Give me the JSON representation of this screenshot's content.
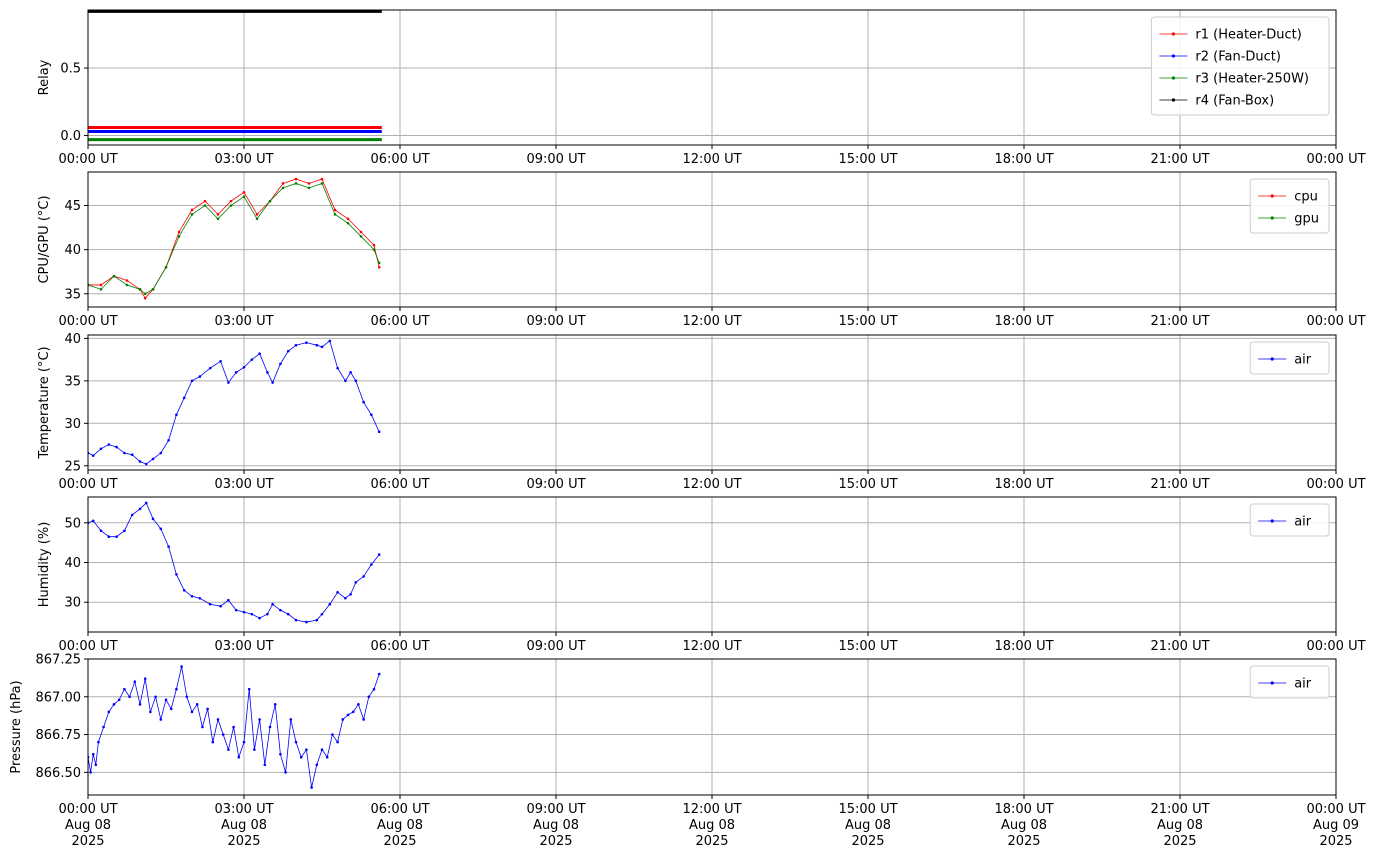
{
  "chart_data": [
    {
      "type": "line",
      "ylabel": "Relay",
      "ylim": [
        -0.07,
        0.93
      ],
      "yticks": [
        {
          "v": 0.0,
          "label": "0.0"
        },
        {
          "v": 0.5,
          "label": "0.5"
        }
      ],
      "x_range": [
        "00:00",
        "24:00"
      ],
      "x_tick_labels": [
        "00:00 UT",
        "03:00 UT",
        "06:00 UT",
        "09:00 UT",
        "12:00 UT",
        "15:00 UT",
        "18:00 UT",
        "21:00 UT",
        "00:00 UT"
      ],
      "grid": true,
      "legend_placement": "top-right",
      "series": [
        {
          "name": "r1 (Heater-Duct)",
          "color": "#ff0000",
          "x": [
            0,
            5.65
          ],
          "y": [
            0.06,
            0.06
          ]
        },
        {
          "name": "r2 (Fan-Duct)",
          "color": "#0000ff",
          "x": [
            0,
            5.65
          ],
          "y": [
            0.03,
            0.03
          ]
        },
        {
          "name": "r3 (Heater-250W)",
          "color": "#008000",
          "x": [
            0,
            5.65
          ],
          "y": [
            -0.03,
            -0.03
          ]
        },
        {
          "name": "r4 (Fan-Box)",
          "color": "#000000",
          "x": [
            0,
            5.65
          ],
          "y": [
            0.92,
            0.92
          ]
        }
      ]
    },
    {
      "type": "line",
      "ylabel": "CPU/GPU (°C)",
      "ylim": [
        33.5,
        48.8
      ],
      "yticks": [
        {
          "v": 35,
          "label": "35"
        },
        {
          "v": 40,
          "label": "40"
        },
        {
          "v": 45,
          "label": "45"
        }
      ],
      "x_range": [
        "00:00",
        "24:00"
      ],
      "x_tick_labels": [
        "00:00 UT",
        "03:00 UT",
        "06:00 UT",
        "09:00 UT",
        "12:00 UT",
        "15:00 UT",
        "18:00 UT",
        "21:00 UT",
        "00:00 UT"
      ],
      "grid": true,
      "legend_placement": "top-right",
      "series": [
        {
          "name": "cpu",
          "color": "#ff0000",
          "x": [
            0,
            0.25,
            0.5,
            0.75,
            1.0,
            1.1,
            1.25,
            1.5,
            1.75,
            2.0,
            2.25,
            2.5,
            2.75,
            3.0,
            3.25,
            3.5,
            3.75,
            4.0,
            4.25,
            4.5,
            4.75,
            5.0,
            5.25,
            5.5,
            5.6
          ],
          "y": [
            36.0,
            36.0,
            37.0,
            36.5,
            35.5,
            34.5,
            35.5,
            38.0,
            42.0,
            44.5,
            45.5,
            44.0,
            45.5,
            46.5,
            44.0,
            45.5,
            47.5,
            48.0,
            47.5,
            48.0,
            44.5,
            43.5,
            42.0,
            40.5,
            38.0
          ]
        },
        {
          "name": "gpu",
          "color": "#008000",
          "x": [
            0,
            0.25,
            0.5,
            0.75,
            1.0,
            1.1,
            1.25,
            1.5,
            1.75,
            2.0,
            2.25,
            2.5,
            2.75,
            3.0,
            3.25,
            3.5,
            3.75,
            4.0,
            4.25,
            4.5,
            4.75,
            5.0,
            5.25,
            5.5,
            5.6
          ],
          "y": [
            36.0,
            35.5,
            37.0,
            36.0,
            35.5,
            35.0,
            35.5,
            38.0,
            41.5,
            44.0,
            45.0,
            43.5,
            45.0,
            46.0,
            43.5,
            45.5,
            47.0,
            47.5,
            47.0,
            47.5,
            44.0,
            43.0,
            41.5,
            40.0,
            38.5
          ]
        }
      ]
    },
    {
      "type": "line",
      "ylabel": "Temperature (°C)",
      "ylim": [
        24.5,
        40.4
      ],
      "yticks": [
        {
          "v": 25,
          "label": "25"
        },
        {
          "v": 30,
          "label": "30"
        },
        {
          "v": 35,
          "label": "35"
        },
        {
          "v": 40,
          "label": "40"
        }
      ],
      "x_range": [
        "00:00",
        "24:00"
      ],
      "x_tick_labels": [
        "00:00 UT",
        "03:00 UT",
        "06:00 UT",
        "09:00 UT",
        "12:00 UT",
        "15:00 UT",
        "18:00 UT",
        "21:00 UT",
        "00:00 UT"
      ],
      "grid": true,
      "legend_placement": "top-right",
      "series": [
        {
          "name": "air",
          "color": "#0000ff",
          "x": [
            0,
            0.1,
            0.25,
            0.4,
            0.55,
            0.7,
            0.85,
            1.0,
            1.12,
            1.25,
            1.4,
            1.55,
            1.7,
            1.85,
            2.0,
            2.15,
            2.35,
            2.55,
            2.7,
            2.85,
            3.0,
            3.15,
            3.3,
            3.45,
            3.55,
            3.7,
            3.85,
            4.0,
            4.2,
            4.4,
            4.5,
            4.65,
            4.8,
            4.95,
            5.05,
            5.15,
            5.3,
            5.45,
            5.6
          ],
          "y": [
            26.5,
            26.2,
            27.0,
            27.5,
            27.2,
            26.5,
            26.3,
            25.5,
            25.2,
            25.8,
            26.5,
            28.0,
            31.0,
            33.0,
            35.0,
            35.5,
            36.5,
            37.3,
            34.8,
            36.0,
            36.6,
            37.5,
            38.2,
            36.0,
            34.8,
            37.0,
            38.5,
            39.2,
            39.5,
            39.2,
            39.0,
            39.7,
            36.5,
            35.0,
            36.0,
            35.0,
            32.5,
            31.0,
            29.0
          ]
        }
      ]
    },
    {
      "type": "line",
      "ylabel": "Humidity (%)",
      "ylim": [
        22.5,
        56.5
      ],
      "yticks": [
        {
          "v": 30,
          "label": "30"
        },
        {
          "v": 40,
          "label": "40"
        },
        {
          "v": 50,
          "label": "50"
        }
      ],
      "x_range": [
        "00:00",
        "24:00"
      ],
      "x_tick_labels": [
        "00:00 UT",
        "03:00 UT",
        "06:00 UT",
        "09:00 UT",
        "12:00 UT",
        "15:00 UT",
        "18:00 UT",
        "21:00 UT",
        "00:00 UT"
      ],
      "grid": true,
      "legend_placement": "top-right",
      "series": [
        {
          "name": "air",
          "color": "#0000ff",
          "x": [
            0,
            0.1,
            0.25,
            0.4,
            0.55,
            0.7,
            0.85,
            1.0,
            1.12,
            1.25,
            1.4,
            1.55,
            1.7,
            1.85,
            2.0,
            2.15,
            2.35,
            2.55,
            2.7,
            2.85,
            3.0,
            3.15,
            3.3,
            3.45,
            3.55,
            3.7,
            3.85,
            4.0,
            4.2,
            4.4,
            4.5,
            4.65,
            4.8,
            4.95,
            5.05,
            5.15,
            5.3,
            5.45,
            5.6
          ],
          "y": [
            50.0,
            50.5,
            48.0,
            46.5,
            46.5,
            48.0,
            52.0,
            53.5,
            55.0,
            51.0,
            48.5,
            44.0,
            37.0,
            33.0,
            31.5,
            31.0,
            29.5,
            29.0,
            30.5,
            28.0,
            27.5,
            27.0,
            26.0,
            27.0,
            29.5,
            28.0,
            27.0,
            25.5,
            25.0,
            25.5,
            27.0,
            29.5,
            32.5,
            31.0,
            32.0,
            35.0,
            36.5,
            39.5,
            42.0
          ]
        }
      ]
    },
    {
      "type": "line",
      "ylabel": "Pressure (hPa)",
      "ylim": [
        866.35,
        867.25
      ],
      "yticks": [
        {
          "v": 866.5,
          "label": "866.50"
        },
        {
          "v": 866.75,
          "label": "866.75"
        },
        {
          "v": 867.0,
          "label": "867.00"
        },
        {
          "v": 867.25,
          "label": "867.25"
        }
      ],
      "x_range": [
        "00:00",
        "24:00"
      ],
      "x_tick_labels": [
        "00:00 UT\nAug 08\n2025",
        "03:00 UT\nAug 08\n2025",
        "06:00 UT\nAug 08\n2025",
        "09:00 UT\nAug 08\n2025",
        "12:00 UT\nAug 08\n2025",
        "15:00 UT\nAug 08\n2025",
        "18:00 UT\nAug 08\n2025",
        "21:00 UT\nAug 08\n2025",
        "00:00 UT\nAug 09\n2025"
      ],
      "grid": true,
      "legend_placement": "top-right",
      "series": [
        {
          "name": "air",
          "color": "#0000ff",
          "x": [
            0,
            0.05,
            0.1,
            0.15,
            0.2,
            0.3,
            0.4,
            0.5,
            0.6,
            0.7,
            0.8,
            0.9,
            1.0,
            1.1,
            1.2,
            1.3,
            1.4,
            1.5,
            1.6,
            1.7,
            1.8,
            1.9,
            2.0,
            2.1,
            2.2,
            2.3,
            2.4,
            2.5,
            2.6,
            2.7,
            2.8,
            2.9,
            3.0,
            3.1,
            3.2,
            3.3,
            3.4,
            3.5,
            3.6,
            3.7,
            3.8,
            3.9,
            4.0,
            4.1,
            4.2,
            4.3,
            4.4,
            4.5,
            4.6,
            4.7,
            4.8,
            4.9,
            5.0,
            5.1,
            5.2,
            5.3,
            5.4,
            5.5,
            5.6
          ],
          "y": [
            866.6,
            866.5,
            866.62,
            866.55,
            866.7,
            866.8,
            866.9,
            866.95,
            866.98,
            867.05,
            867.0,
            867.1,
            866.95,
            867.12,
            866.9,
            867.0,
            866.85,
            866.98,
            866.92,
            867.05,
            867.2,
            867.0,
            866.9,
            866.95,
            866.8,
            866.92,
            866.7,
            866.85,
            866.75,
            866.65,
            866.8,
            866.6,
            866.7,
            867.05,
            866.65,
            866.85,
            866.55,
            866.8,
            866.95,
            866.62,
            866.5,
            866.85,
            866.7,
            866.6,
            866.65,
            866.4,
            866.55,
            866.65,
            866.6,
            866.75,
            866.7,
            866.85,
            866.88,
            866.9,
            866.95,
            866.85,
            867.0,
            867.05,
            867.15
          ]
        }
      ]
    }
  ]
}
